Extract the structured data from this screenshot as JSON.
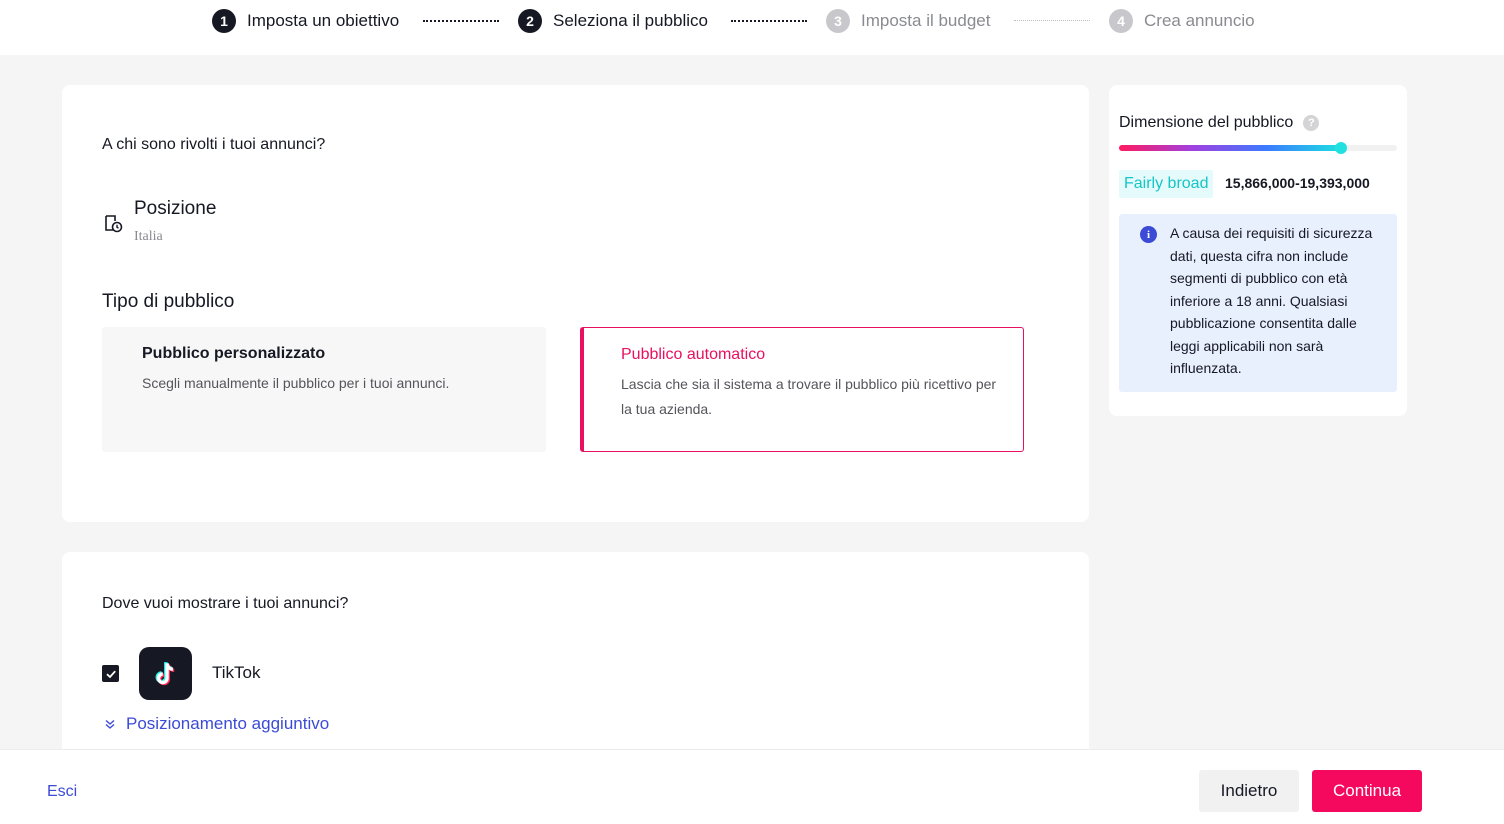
{
  "stepper": {
    "steps": [
      {
        "number": "1",
        "label": "Imposta un obiettivo",
        "state": "done"
      },
      {
        "number": "2",
        "label": "Seleziona il pubblico",
        "state": "current"
      },
      {
        "number": "3",
        "label": "Imposta il budget",
        "state": "upcoming"
      },
      {
        "number": "4",
        "label": "Crea annuncio",
        "state": "upcoming"
      }
    ]
  },
  "audience": {
    "question": "A chi sono rivolti i tuoi annunci?",
    "location": {
      "icon": "location-pin-icon",
      "title": "Posizione",
      "value": "Italia"
    },
    "type_title": "Tipo di pubblico",
    "options": [
      {
        "title": "Pubblico personalizzato",
        "description": "Scegli manualmente il pubblico per i tuoi annunci.",
        "selected": false
      },
      {
        "title": "Pubblico automatico",
        "description": "Lascia che sia il sistema a trovare il pubblico più ricettivo per la tua azienda.",
        "selected": true
      }
    ]
  },
  "placement": {
    "question": "Dove vuoi mostrare i tuoi annunci?",
    "platform": {
      "label": "TikTok",
      "checked": true,
      "icon": "tiktok-logo-icon"
    },
    "more_link": "Posizionamento aggiuntivo"
  },
  "audience_size": {
    "title": "Dimensione del pubblico",
    "help_icon": "?",
    "meter_level": 0.8,
    "breadth_label": "Fairly broad",
    "range": "15,866,000-19,393,000",
    "info_icon": "i",
    "info_text": "A causa dei requisiti di sicurezza dati, questa cifra non include segmenti di pubblico con età inferiore a 18 anni. Qualsiasi pubblicazione consentita dalle leggi applicabili non sarà influenzata."
  },
  "colors": {
    "accent": "#f5095e",
    "link": "#3b4bd6",
    "teal": "#16c5c5"
  },
  "footer": {
    "exit_label": "Esci",
    "back_label": "Indietro",
    "continue_label": "Continua"
  }
}
